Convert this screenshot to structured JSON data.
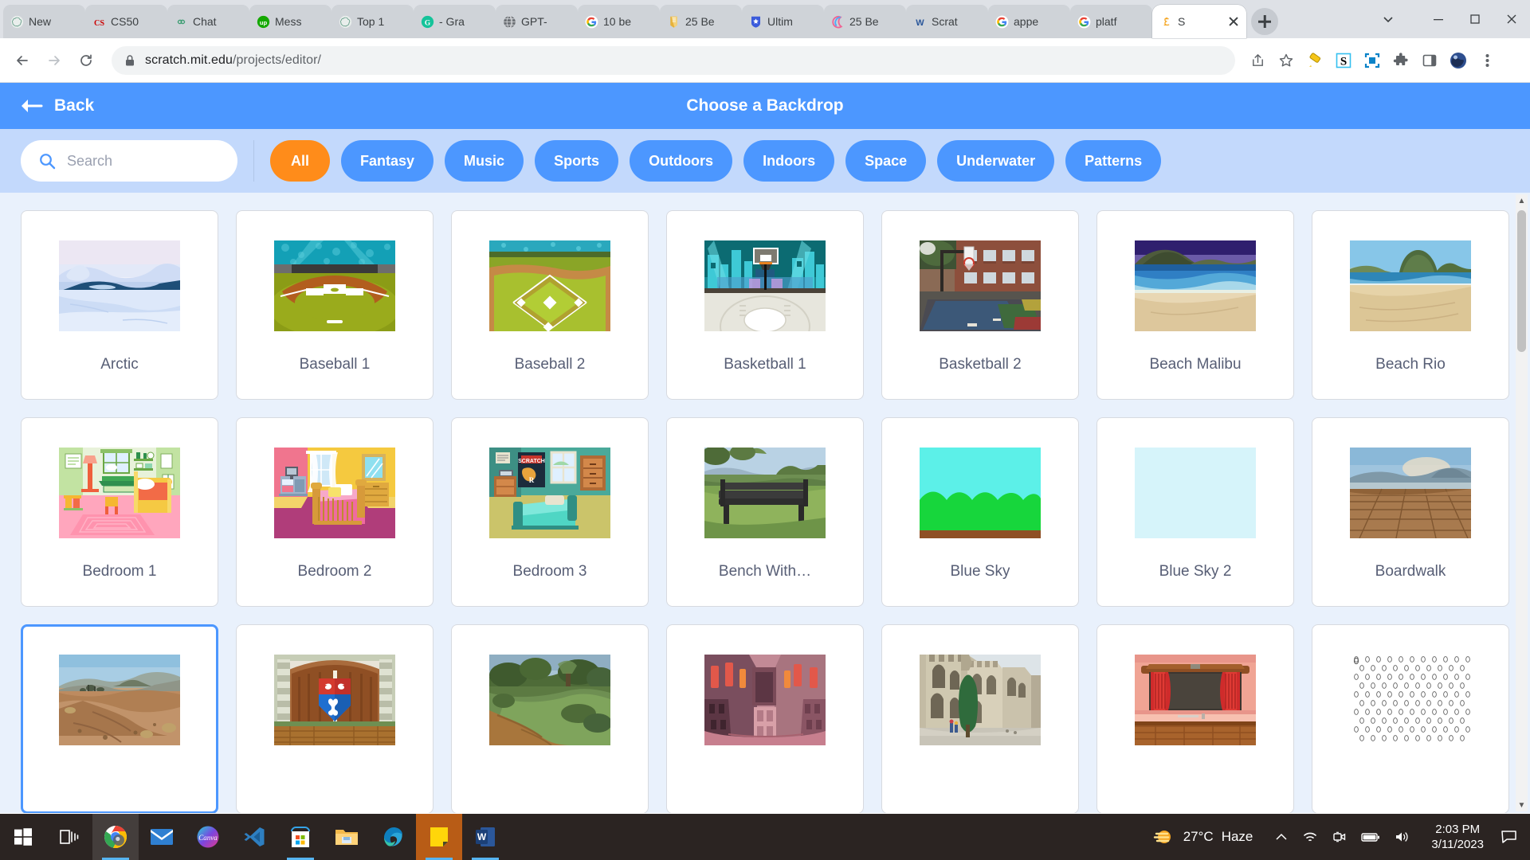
{
  "browser": {
    "tabs": [
      {
        "title": "New",
        "favicon": "openai-icon",
        "active": false
      },
      {
        "title": "CS50",
        "favicon": "cs50-icon",
        "active": false
      },
      {
        "title": "Chat",
        "favicon": "infinity-icon",
        "active": false
      },
      {
        "title": "Mess",
        "favicon": "upwork-icon",
        "active": false
      },
      {
        "title": "Top 1",
        "favicon": "openai-icon",
        "active": false
      },
      {
        "title": "- Gra",
        "favicon": "grammarly-icon",
        "active": false
      },
      {
        "title": "GPT-",
        "favicon": "globe-icon",
        "active": false
      },
      {
        "title": "10 be",
        "favicon": "google-icon",
        "active": false
      },
      {
        "title": "25 Be",
        "favicon": "book-icon",
        "active": false
      },
      {
        "title": "Ultim",
        "favicon": "badge-icon",
        "active": false
      },
      {
        "title": "25 Be",
        "favicon": "moon-icon",
        "active": false
      },
      {
        "title": "Scrat",
        "favicon": "word-icon",
        "active": false
      },
      {
        "title": "appe",
        "favicon": "google-icon",
        "active": false
      },
      {
        "title": "platf",
        "favicon": "google-icon",
        "active": false
      },
      {
        "title": "S",
        "favicon": "scratch-icon",
        "active": true
      }
    ],
    "new_tab_label": "+",
    "window_controls": [
      "chevron-down",
      "minimize",
      "maximize",
      "close"
    ],
    "address": {
      "host": "scratch.mit.edu",
      "path": "/projects/editor/",
      "lock_icon": "lock-icon"
    },
    "toolbar_icons": [
      "share-icon",
      "bookmark-star-icon",
      "highlighter-icon",
      "s-extension-icon",
      "screenshot-icon",
      "puzzle-extension-icon",
      "side-panel-icon",
      "globe-profile-icon",
      "three-dot-menu-icon"
    ],
    "nav": {
      "back": "back-arrow-icon",
      "forward": "forward-arrow-icon",
      "reload": "reload-icon"
    }
  },
  "scratch": {
    "header": {
      "back_label": "Back",
      "back_icon": "arrow-left-icon",
      "title": "Choose a Backdrop"
    },
    "search": {
      "placeholder": "Search",
      "value": "",
      "icon": "search-icon"
    },
    "tags": [
      {
        "label": "All",
        "active": true
      },
      {
        "label": "Fantasy",
        "active": false
      },
      {
        "label": "Music",
        "active": false
      },
      {
        "label": "Sports",
        "active": false
      },
      {
        "label": "Outdoors",
        "active": false
      },
      {
        "label": "Indoors",
        "active": false
      },
      {
        "label": "Space",
        "active": false
      },
      {
        "label": "Underwater",
        "active": false
      },
      {
        "label": "Patterns",
        "active": false
      }
    ],
    "colors": {
      "header_blue": "#4c97ff",
      "filter_bar_blue": "#c3d9fc",
      "active_tag_orange": "#ff8c1a",
      "body_bg": "#e9f1fc",
      "label_text": "#575e75",
      "selection_border": "#4c97ff"
    },
    "backdrops": [
      {
        "name": "Arctic",
        "art": "arctic",
        "selected": false
      },
      {
        "name": "Baseball 1",
        "art": "baseball1",
        "selected": false
      },
      {
        "name": "Baseball 2",
        "art": "baseball2",
        "selected": false
      },
      {
        "name": "Basketball 1",
        "art": "basketball1",
        "selected": false
      },
      {
        "name": "Basketball 2",
        "art": "basketball2",
        "selected": false
      },
      {
        "name": "Beach Malibu",
        "art": "beachmalibu",
        "selected": false
      },
      {
        "name": "Beach Rio",
        "art": "beachrio",
        "selected": false
      },
      {
        "name": "Bedroom 1",
        "art": "bedroom1",
        "selected": false
      },
      {
        "name": "Bedroom 2",
        "art": "bedroom2",
        "selected": false
      },
      {
        "name": "Bedroom 3",
        "art": "bedroom3",
        "selected": false
      },
      {
        "name": "Bench With…",
        "art": "bench",
        "selected": false
      },
      {
        "name": "Blue Sky",
        "art": "bluesky",
        "selected": false
      },
      {
        "name": "Blue Sky 2",
        "art": "bluesky2",
        "selected": false
      },
      {
        "name": "Boardwalk",
        "art": "boardwalk",
        "selected": false
      },
      {
        "name": "",
        "art": "canyon",
        "selected": true
      },
      {
        "name": "",
        "art": "castle1",
        "selected": false
      },
      {
        "name": "",
        "art": "castle2",
        "selected": false
      },
      {
        "name": "",
        "art": "castle3",
        "selected": false
      },
      {
        "name": "",
        "art": "castle4",
        "selected": false
      },
      {
        "name": "",
        "art": "theater",
        "selected": false
      },
      {
        "name": "",
        "art": "chalkboard",
        "selected": false
      }
    ],
    "scroll": {
      "up_arrow": "▲",
      "down_arrow": "▼"
    }
  },
  "taskbar": {
    "start_icon": "windows-start-icon",
    "task_view_icon": "task-view-icon",
    "apps": [
      {
        "name": "chrome-icon",
        "running": true,
        "state": "highlight"
      },
      {
        "name": "mail-icon",
        "running": false,
        "state": "none"
      },
      {
        "name": "canva-icon",
        "running": false,
        "state": "none"
      },
      {
        "name": "vscode-icon",
        "running": false,
        "state": "none"
      },
      {
        "name": "microsoft-store-icon",
        "running": true,
        "state": "none"
      },
      {
        "name": "file-explorer-icon",
        "running": false,
        "state": "none"
      },
      {
        "name": "edge-icon",
        "running": false,
        "state": "none"
      },
      {
        "name": "sticky-notes-icon",
        "running": true,
        "state": "highlight-orange"
      },
      {
        "name": "word-icon",
        "running": true,
        "state": "none"
      }
    ],
    "weather": {
      "icon": "haze-sun-icon",
      "temp": "27°C",
      "condition": "Haze"
    },
    "tray": [
      "chevron-up-icon",
      "wifi-icon",
      "meet-now-icon",
      "battery-icon",
      "volume-icon"
    ],
    "clock": {
      "time": "2:03 PM",
      "date": "3/11/2023"
    },
    "notification_icon": "notification-icon"
  }
}
